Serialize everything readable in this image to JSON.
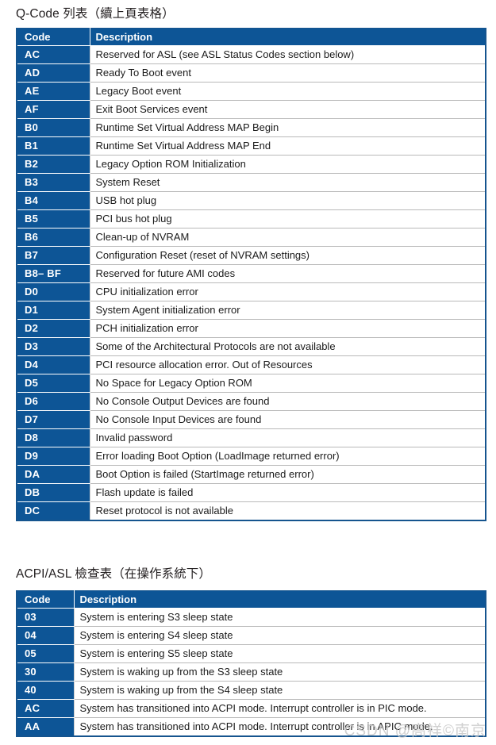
{
  "document": {
    "background_color": "#ffffff",
    "accent_color": "#0d5596",
    "border_color": "#15548e",
    "rule_color": "#b9b9b9"
  },
  "watermark": {
    "text": "CSDN @高祥©南京"
  },
  "qcode_section": {
    "title": "Q-Code 列表（續上頁表格）",
    "columns": [
      "Code",
      "Description"
    ],
    "rows": [
      {
        "code": "AC",
        "description": "Reserved for ASL (see ASL Status Codes section below)"
      },
      {
        "code": "AD",
        "description": "Ready To Boot event"
      },
      {
        "code": "AE",
        "description": "Legacy Boot event"
      },
      {
        "code": "AF",
        "description": "Exit Boot Services event"
      },
      {
        "code": "B0",
        "description": "Runtime Set Virtual Address MAP Begin"
      },
      {
        "code": "B1",
        "description": "Runtime Set Virtual Address MAP End"
      },
      {
        "code": "B2",
        "description": "Legacy Option ROM Initialization"
      },
      {
        "code": "B3",
        "description": "System Reset"
      },
      {
        "code": "B4",
        "description": "USB hot plug"
      },
      {
        "code": "B5",
        "description": "PCI bus hot plug"
      },
      {
        "code": "B6",
        "description": "Clean-up of NVRAM"
      },
      {
        "code": "B7",
        "description": "Configuration Reset (reset of NVRAM settings)"
      },
      {
        "code": "B8– BF",
        "description": "Reserved for future AMI codes"
      },
      {
        "code": "D0",
        "description": "CPU initialization error"
      },
      {
        "code": "D1",
        "description": "System Agent initialization error"
      },
      {
        "code": "D2",
        "description": "PCH initialization error"
      },
      {
        "code": "D3",
        "description": "Some of the Architectural Protocols are not available"
      },
      {
        "code": "D4",
        "description": "PCI resource allocation error. Out of Resources"
      },
      {
        "code": "D5",
        "description": "No Space for Legacy Option ROM"
      },
      {
        "code": "D6",
        "description": "No Console Output Devices are found"
      },
      {
        "code": "D7",
        "description": "No Console Input Devices are found"
      },
      {
        "code": "D8",
        "description": "Invalid password"
      },
      {
        "code": "D9",
        "description": "Error loading Boot Option (LoadImage returned error)"
      },
      {
        "code": "DA",
        "description": "Boot Option is failed (StartImage returned error)"
      },
      {
        "code": "DB",
        "description": "Flash update is failed"
      },
      {
        "code": "DC",
        "description": "Reset protocol is not available"
      }
    ]
  },
  "acpi_section": {
    "title": "ACPI/ASL 檢查表（在操作系統下）",
    "columns": [
      "Code",
      "Description"
    ],
    "rows": [
      {
        "code": "03",
        "description": "System is entering S3 sleep state"
      },
      {
        "code": "04",
        "description": "System is entering S4 sleep state"
      },
      {
        "code": "05",
        "description": "System is entering S5 sleep state"
      },
      {
        "code": "30",
        "description": "System is waking up from the S3 sleep state"
      },
      {
        "code": "40",
        "description": "System is waking up from the S4 sleep state"
      },
      {
        "code": "AC",
        "description": "System has transitioned into ACPI mode. Interrupt controller is in PIC mode."
      },
      {
        "code": "AA",
        "description": "System has transitioned into ACPI mode. Interrupt controller is in APIC mode."
      }
    ]
  }
}
